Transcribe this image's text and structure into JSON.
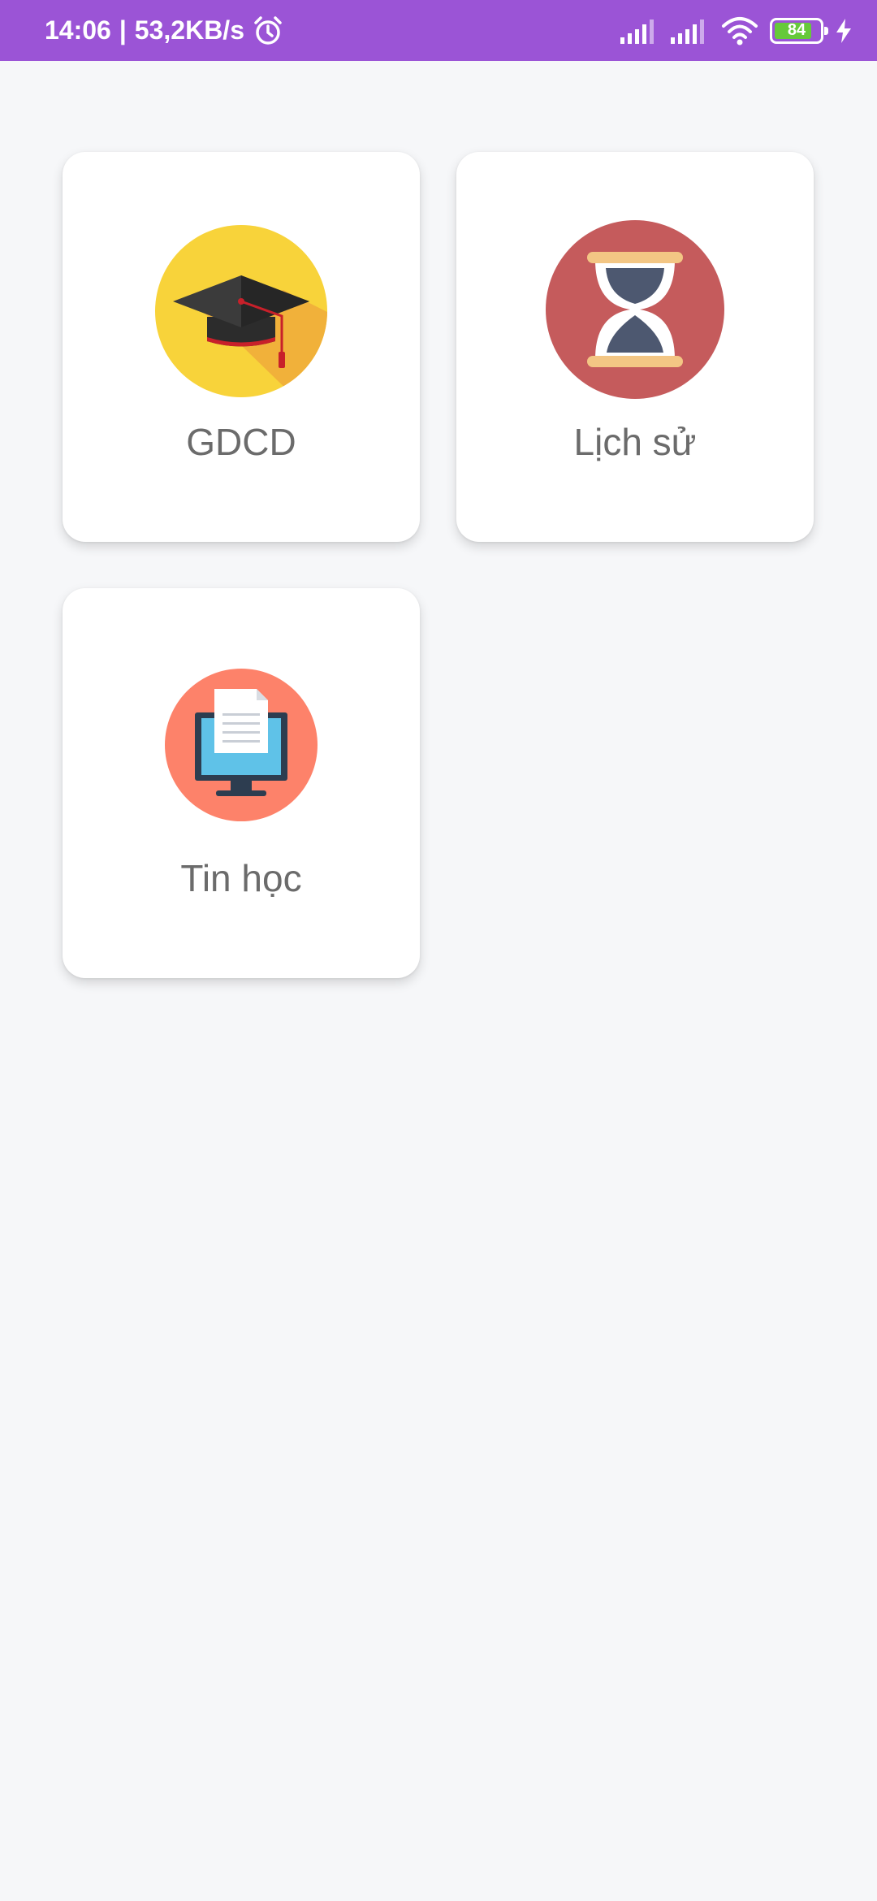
{
  "status_bar": {
    "time": "14:06",
    "separator": "|",
    "speed": "53,2KB/s",
    "battery_level": "84",
    "battery_fraction": 0.84,
    "icons": [
      "alarm-icon",
      "signal-1-icon",
      "signal-2-icon",
      "wifi-icon",
      "battery-icon",
      "charging-icon"
    ]
  },
  "subjects": [
    {
      "label": "GDCD",
      "icon": "graduation-cap-icon",
      "color": "#f8d33a"
    },
    {
      "label": "Lịch sử",
      "icon": "hourglass-icon",
      "color": "#c55b5c"
    },
    {
      "label": "Tin học",
      "icon": "computer-document-icon",
      "color": "#fd826a"
    }
  ],
  "colors": {
    "status_bar": "#9b54d6",
    "background": "#f6f7f9",
    "card": "#ffffff",
    "label_text": "#6b6b6b"
  }
}
